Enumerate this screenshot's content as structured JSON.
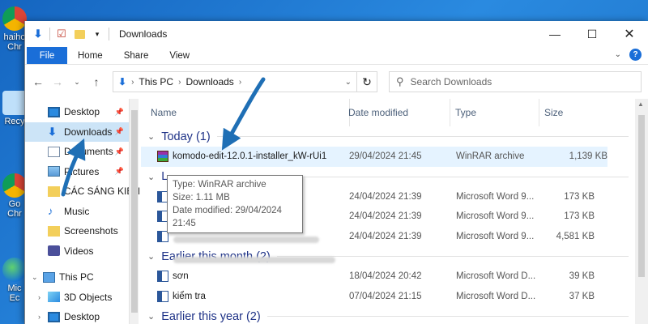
{
  "desktop": {
    "icons": [
      {
        "label": "haiho",
        "label2": "Chr",
        "color": "#db4437"
      },
      {
        "label": "Recy",
        "label2": "",
        "color": "#9ec9ef"
      },
      {
        "label": "Go",
        "label2": "Chr",
        "color": "#e8b400"
      },
      {
        "label": "Mic",
        "label2": "Ec",
        "color": "#2f9ae0"
      }
    ]
  },
  "window": {
    "title": "Downloads",
    "ribbon_tabs": [
      "File",
      "Home",
      "Share",
      "View"
    ],
    "breadcrumb": [
      "This PC",
      "Downloads"
    ],
    "search_placeholder": "Search Downloads",
    "help_label": "?"
  },
  "nav": {
    "quick_access": [
      {
        "label": "Desktop",
        "icon": "desktop-icon",
        "pinned": true
      },
      {
        "label": "Downloads",
        "icon": "download-icon",
        "pinned": true,
        "selected": true
      },
      {
        "label": "Documents",
        "icon": "documents-icon",
        "pinned": true
      },
      {
        "label": "Pictures",
        "icon": "pictures-icon",
        "pinned": true
      },
      {
        "label": "CÁC SÁNG KIẾN",
        "icon": "folder-icon",
        "pinned": false
      },
      {
        "label": "Music",
        "icon": "music-icon",
        "pinned": false
      },
      {
        "label": "Screenshots",
        "icon": "folder-icon",
        "pinned": false
      },
      {
        "label": "Videos",
        "icon": "videos-icon",
        "pinned": false
      }
    ],
    "this_pc": "This PC",
    "this_pc_children": [
      "3D Objects",
      "Desktop"
    ]
  },
  "columns": {
    "name": "Name",
    "date": "Date modified",
    "type": "Type",
    "size": "Size"
  },
  "groups": [
    {
      "title": "Today (1)",
      "rows": [
        {
          "name": "komodo-edit-12.0.1-installer_kW-rUi1",
          "date": "29/04/2024 21:45",
          "type": "WinRAR archive",
          "size": "1,139 KB",
          "icon": "winrar",
          "hl": true
        }
      ]
    },
    {
      "title": "L",
      "rows": [
        {
          "name": "",
          "date": "24/04/2024 21:39",
          "type": "Microsoft Word 9...",
          "size": "173 KB",
          "icon": "word"
        },
        {
          "name": "",
          "date": "24/04/2024 21:39",
          "type": "Microsoft Word 9...",
          "size": "173 KB",
          "icon": "word"
        },
        {
          "name": "",
          "date": "24/04/2024 21:39",
          "type": "Microsoft Word 9...",
          "size": "4,581 KB",
          "icon": "word"
        }
      ]
    },
    {
      "title": "Earlier this month (2)",
      "rows": [
        {
          "name": "sơn",
          "date": "18/04/2024 20:42",
          "type": "Microsoft Word D...",
          "size": "39 KB",
          "icon": "word"
        },
        {
          "name": "kiểm tra",
          "date": "07/04/2024 21:15",
          "type": "Microsoft Word D...",
          "size": "37 KB",
          "icon": "word"
        }
      ]
    },
    {
      "title": "Earlier this year (2)",
      "rows": []
    }
  ],
  "tooltip": {
    "type": "Type: WinRAR archive",
    "size": "Size: 1.11 MB",
    "date": "Date modified: 29/04/2024 21:45"
  },
  "colors": {
    "accent": "#1a6ed8",
    "selection": "#cce4f7",
    "hover": "#e5f3ff",
    "group_text": "#1e3287",
    "annotation_arrow": "#1f6fb5"
  }
}
